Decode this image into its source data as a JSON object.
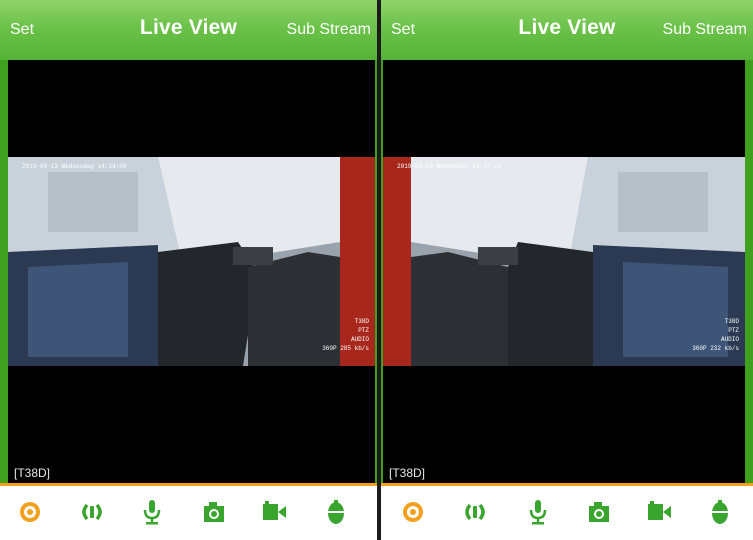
{
  "panels": [
    {
      "header": {
        "left": "Set",
        "title": "Live View",
        "right": "Sub Stream"
      },
      "video": {
        "timestamp": "2019-09-13 Wednesday 14:34:08",
        "info": [
          "T38D",
          "PTZ",
          "AUDIO",
          "360P 285 kb/s"
        ]
      },
      "channel_label": "[T38D]"
    },
    {
      "header": {
        "left": "Set",
        "title": "Live View",
        "right": "Sub Stream"
      },
      "video": {
        "timestamp": "2019-09-13 Wednesday 14:37:21",
        "info": [
          "T38D",
          "PTZ",
          "AUDIO",
          "360P 232 kb/s"
        ]
      },
      "channel_label": "[T38D]"
    }
  ],
  "toolbar_icons": [
    "ptz-icon",
    "speaker-icon",
    "microphone-icon",
    "snapshot-icon",
    "record-icon",
    "hold-to-talk-icon"
  ],
  "colors": {
    "header_green": "#6cc24a",
    "icon_green": "#3aa52e",
    "accent_orange": "#f2a11f"
  }
}
